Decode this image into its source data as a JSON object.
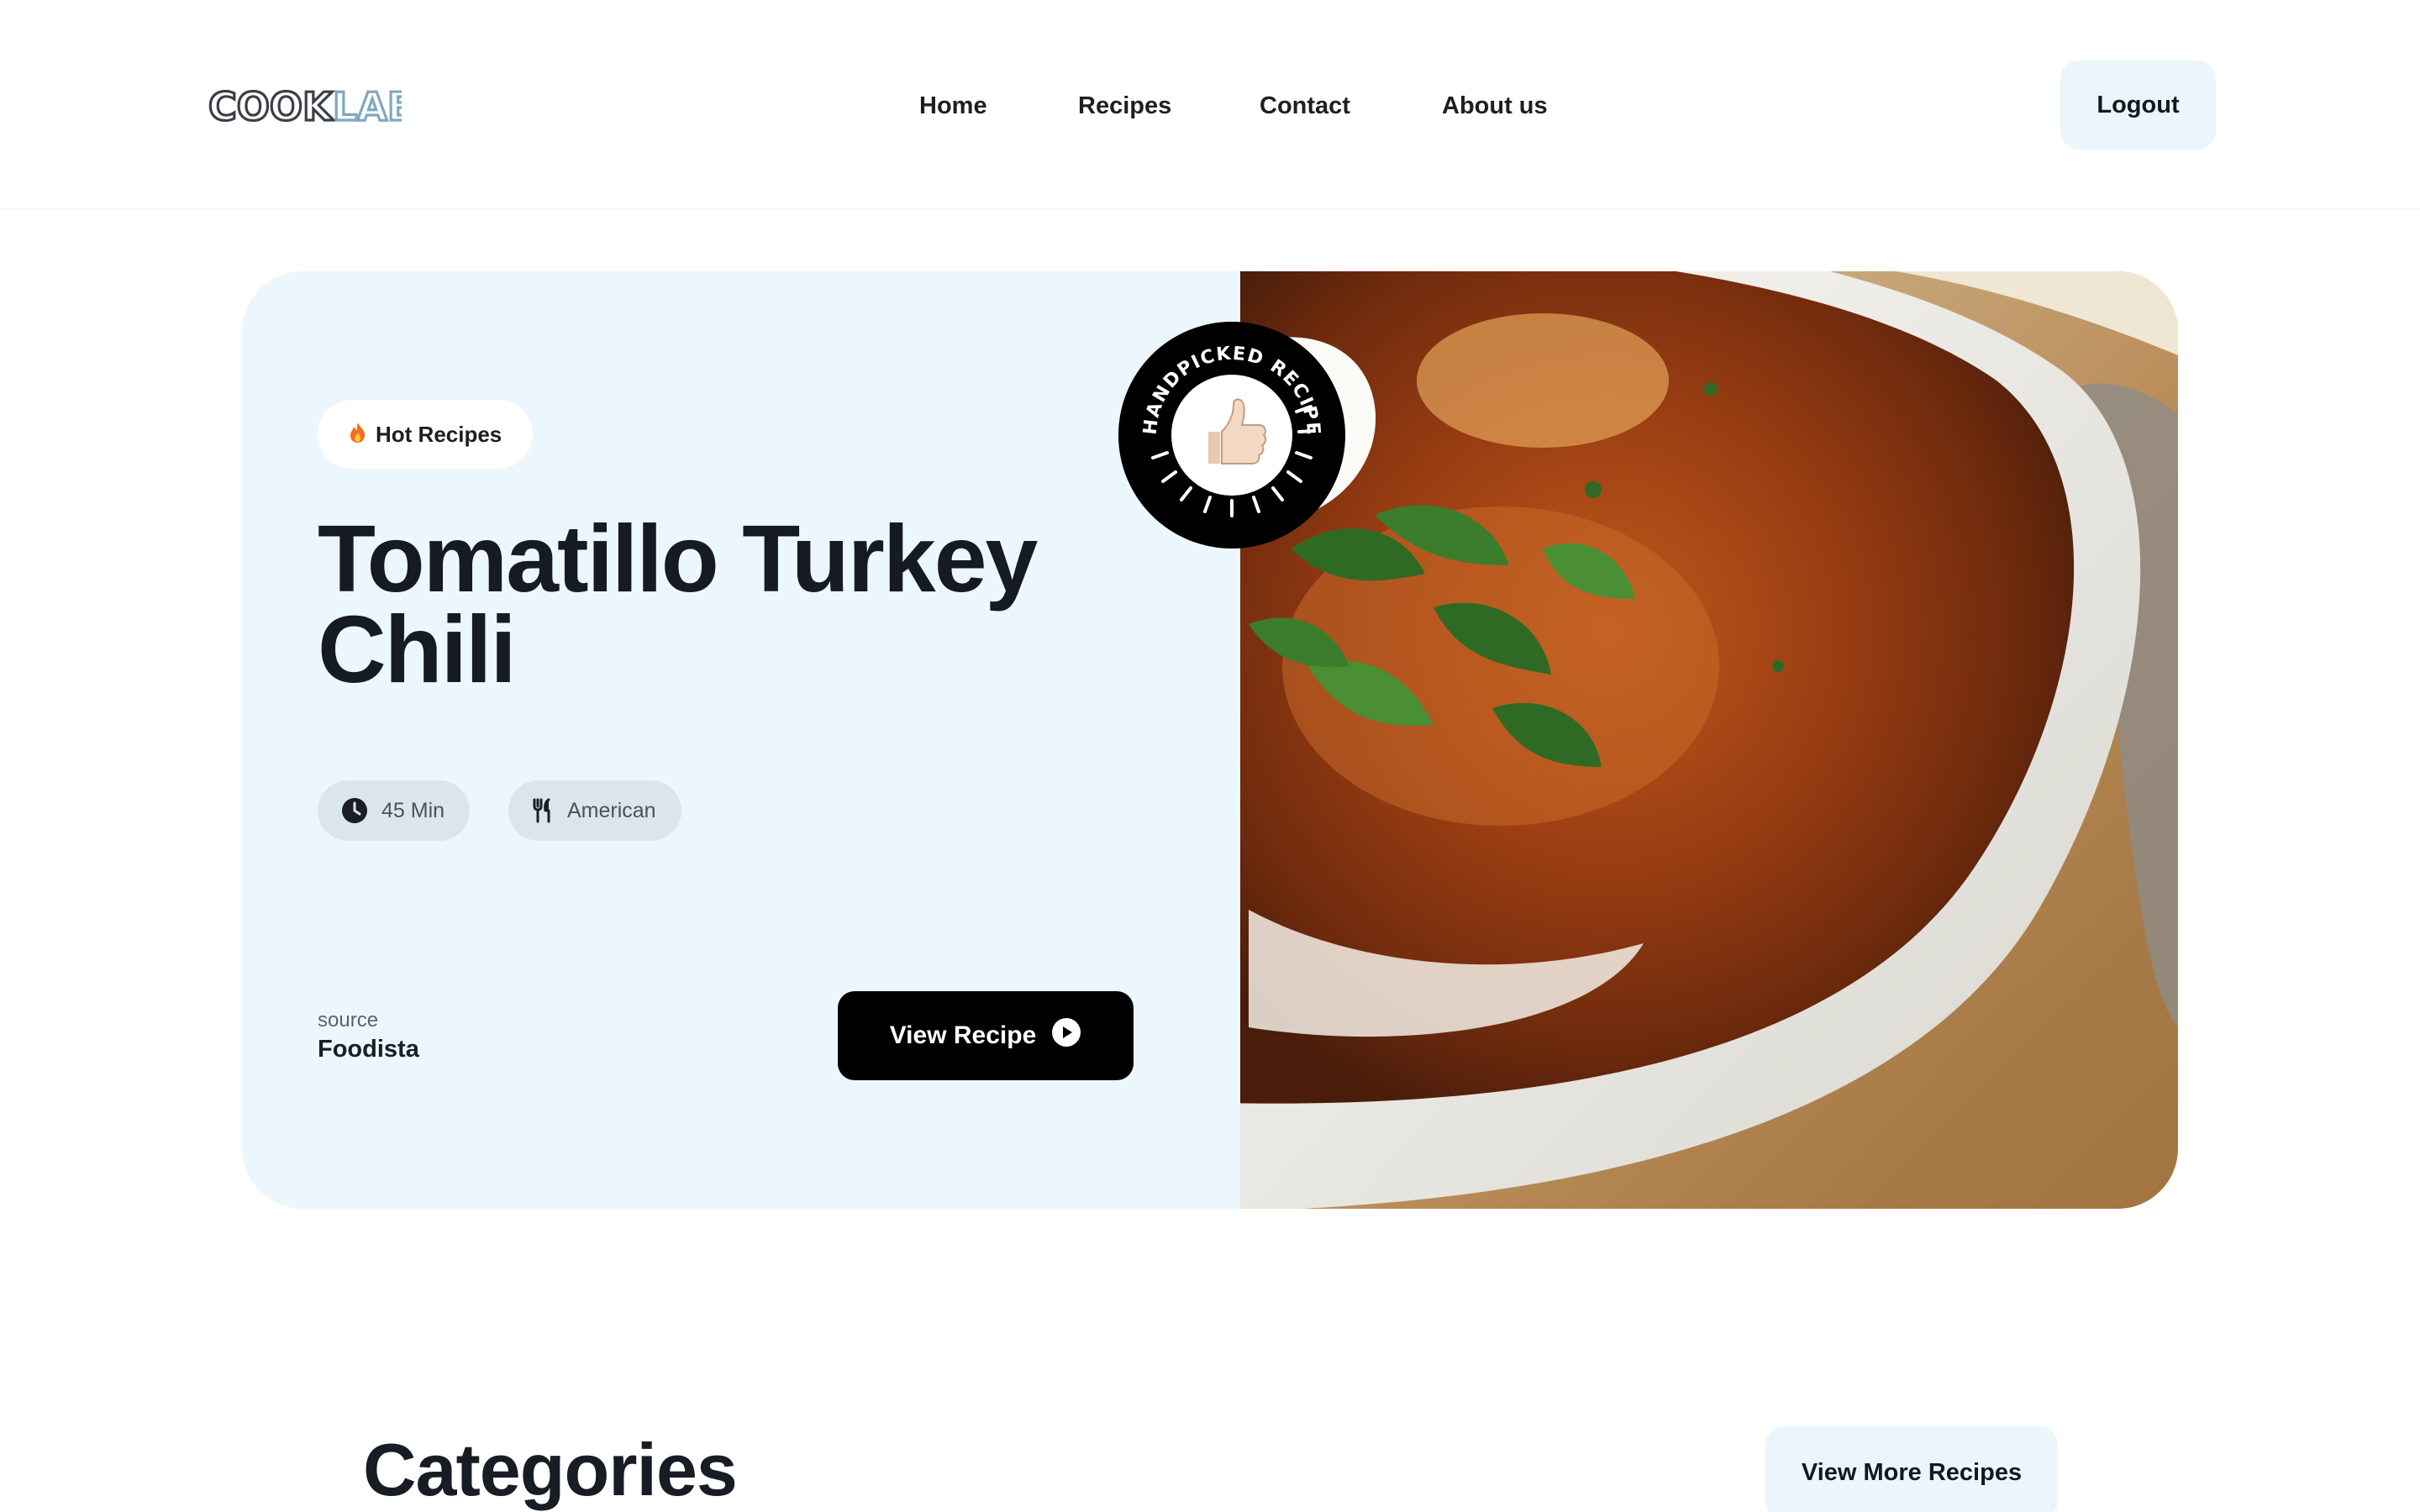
{
  "app": {
    "logo_text": "COOKLAB",
    "brand_colors": {
      "dark": "#3a3f47",
      "accent": "#7fa8bf"
    }
  },
  "nav": {
    "items": [
      {
        "label": "Home"
      },
      {
        "label": "Recipes"
      },
      {
        "label": "Contact"
      },
      {
        "label": "About us"
      }
    ],
    "logout_label": "Logout"
  },
  "hero": {
    "badge_label": "Hot Recipes",
    "badge_icon": "fire-icon",
    "title": "Tomatillo Turkey Chili",
    "meta": [
      {
        "icon": "clock-icon",
        "label": "45 Min"
      },
      {
        "icon": "fork-knife-icon",
        "label": "American"
      }
    ],
    "source_label": "source",
    "source_value": "Foodista",
    "cta_label": "View Recipe",
    "cta_icon": "play-circle-icon",
    "seal_text": "HANDPICKED RECIPES",
    "seal_icon": "thumbs-up-icon",
    "background_color": "#ebf7fc"
  },
  "categories": {
    "title": "Categories",
    "view_more_label": "View More Recipes"
  }
}
